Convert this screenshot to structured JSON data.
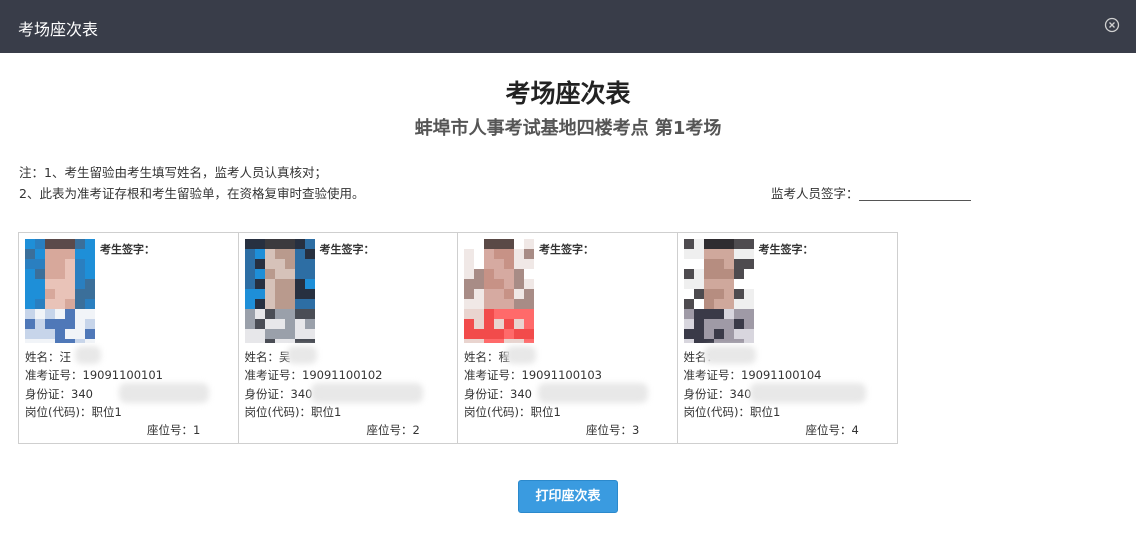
{
  "window": {
    "title": "考场座次表"
  },
  "heading": {
    "title": "考场座次表",
    "subtitle": "蚌埠市人事考试基地四楼考点 第1考场"
  },
  "notes": {
    "line1": "注：1、考生留验由考生填写姓名，监考人员认真核对；",
    "line2": "2、此表为准考证存根和考生留验单，在资格复审时查验使用。",
    "proctor_sign_label": "监考人员签字："
  },
  "card_labels": {
    "candidate_sign": "考生签字：",
    "name": "姓名：",
    "ticket": "准考证号：",
    "id": "身份证：",
    "post": "岗位(代码)：",
    "seat": "座位号："
  },
  "candidates": [
    {
      "name": "汪",
      "ticket": "19091100101",
      "id": "340",
      "post": "职位1",
      "seat": "1",
      "photo_bg": "#1e8fd8"
    },
    {
      "name": "吴",
      "ticket": "19091100102",
      "id": "340",
      "post": "职位1",
      "seat": "2",
      "photo_bg": "#1e8fd8"
    },
    {
      "name": "程",
      "ticket": "19091100103",
      "id": "340",
      "post": "职位1",
      "seat": "3",
      "photo_bg": "#ffffff"
    },
    {
      "name": "",
      "ticket": "19091100104",
      "id": "340",
      "post": "职位1",
      "seat": "4",
      "photo_bg": "#ffffff"
    }
  ],
  "actions": {
    "print_label": "打印座次表"
  },
  "colors": {
    "titlebar": "#393d49",
    "button": "#3a9be0"
  }
}
